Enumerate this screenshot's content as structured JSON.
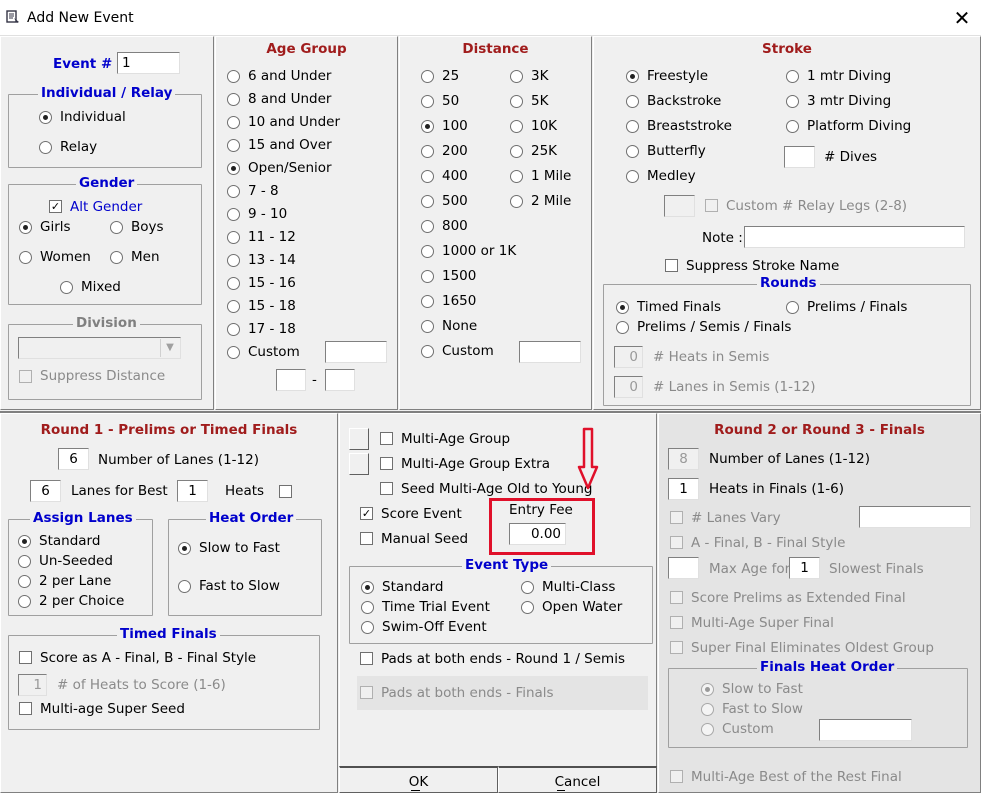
{
  "window": {
    "title": "Add New Event",
    "close_label": "✕"
  },
  "event": {
    "label": "Event # :",
    "value": "1"
  },
  "individual_relay": {
    "title": "Individual / Relay",
    "options": [
      "Individual",
      "Relay"
    ],
    "selected": "Individual"
  },
  "gender": {
    "title": "Gender",
    "alt_gender_label": "Alt Gender",
    "alt_gender_checked": true,
    "options": [
      "Girls",
      "Boys",
      "Women",
      "Men",
      "Mixed"
    ],
    "selected": "Girls"
  },
  "division": {
    "title": "Division",
    "value": "",
    "suppress_distance_label": "Suppress Distance"
  },
  "age_group": {
    "title": "Age Group",
    "options": [
      "6 and Under",
      "8 and Under",
      "10 and Under",
      "15 and Over",
      "Open/Senior",
      "7 - 8",
      "9 - 10",
      "11 - 12",
      "13 - 14",
      "15 - 16",
      "15 - 18",
      "17 - 18",
      "Custom"
    ],
    "selected": "Open/Senior",
    "range_separator": "-"
  },
  "distance": {
    "title": "Distance",
    "col1": [
      "25",
      "50",
      "100",
      "200",
      "400",
      "500",
      "800",
      "1000 or 1K",
      "1500",
      "1650",
      "None",
      "Custom"
    ],
    "col2": [
      "3K",
      "5K",
      "10K",
      "25K",
      "1 Mile",
      "2 Mile"
    ],
    "selected": "100"
  },
  "stroke": {
    "title": "Stroke",
    "col1": [
      "Freestyle",
      "Backstroke",
      "Breaststroke",
      "Butterfly",
      "Medley"
    ],
    "col2": [
      "1 mtr Diving",
      "3 mtr Diving",
      "Platform Diving"
    ],
    "selected": "Freestyle",
    "dives_label": "# Dives",
    "relay_legs_label": "Custom # Relay Legs (2-8)",
    "note_label": "Note :",
    "note_value": "",
    "suppress_stroke_label": "Suppress Stroke Name"
  },
  "rounds": {
    "title": "Rounds",
    "options": [
      "Timed Finals",
      "Prelims / Finals",
      "Prelims / Semis / Finals"
    ],
    "selected": "Timed Finals",
    "heats_semis_value": "0",
    "heats_semis_label": "# Heats in Semis",
    "lanes_semis_value": "0",
    "lanes_semis_label": "# Lanes in Semis (1-12)"
  },
  "round1": {
    "title": "Round 1 - Prelims or Timed Finals",
    "lanes_value": "6",
    "lanes_label": "Number of Lanes (1-12)",
    "best_value": "6",
    "best_label": "Lanes for Best",
    "heats_value": "1",
    "heats_label": "Heats"
  },
  "assign_lanes": {
    "title": "Assign Lanes",
    "options": [
      "Standard",
      "Un-Seeded",
      "2 per Lane",
      "2 per Choice"
    ],
    "selected": "Standard"
  },
  "heat_order": {
    "title": "Heat Order",
    "options": [
      "Slow to Fast",
      "Fast to Slow"
    ],
    "selected": "Slow to Fast"
  },
  "timed_finals": {
    "title": "Timed Finals",
    "score_ab_label": "Score as A - Final, B - Final Style",
    "heats_score_value": "1",
    "heats_score_label": "# of Heats to Score (1-6)",
    "super_seed_label": "Multi-age Super Seed"
  },
  "middle": {
    "multi_age_group_label": "Multi-Age Group",
    "multi_age_extra_label": "Multi-Age Group Extra",
    "seed_multi_label": "Seed Multi-Age Old to Young",
    "score_event_label": "Score Event",
    "score_event_checked": true,
    "manual_seed_label": "Manual Seed",
    "entry_fee_label": "Entry Fee",
    "entry_fee_value": "0.00"
  },
  "event_type": {
    "title": "Event Type",
    "options": [
      "Standard",
      "Multi-Class",
      "Time Trial Event",
      "Open Water",
      "Swim-Off Event"
    ],
    "selected": "Standard",
    "pads_r1_label": "Pads at both ends - Round 1 / Semis",
    "pads_finals_label": "Pads at both ends - Finals"
  },
  "buttons": {
    "ok": "OK",
    "cancel": "Cancel"
  },
  "round23": {
    "title": "Round 2 or Round 3 - Finals",
    "lanes_value": "8",
    "lanes_label": "Number of Lanes (1-12)",
    "heats_value": "1",
    "heats_label": "Heats in Finals (1-6)",
    "lanes_vary_label": "# Lanes Vary",
    "ab_final_label": "A - Final, B - Final Style",
    "max_age_label": "Max Age for",
    "slowest_value": "1",
    "slowest_label": "Slowest Finals",
    "score_prelims_label": "Score Prelims as Extended Final",
    "multi_super_label": "Multi-Age Super Final",
    "super_elim_label": "Super Final Eliminates Oldest Group",
    "finals_heat_order_title": "Finals Heat Order",
    "finals_heat_order_options": [
      "Slow to Fast",
      "Fast to Slow",
      "Custom"
    ],
    "finals_heat_order_selected": "Slow to Fast",
    "best_rest_label": "Multi-Age Best of the Rest Final"
  },
  "colors": {
    "section_header": "#a01c1c",
    "group_header": "#0000cc",
    "highlight": "#e0102a"
  }
}
